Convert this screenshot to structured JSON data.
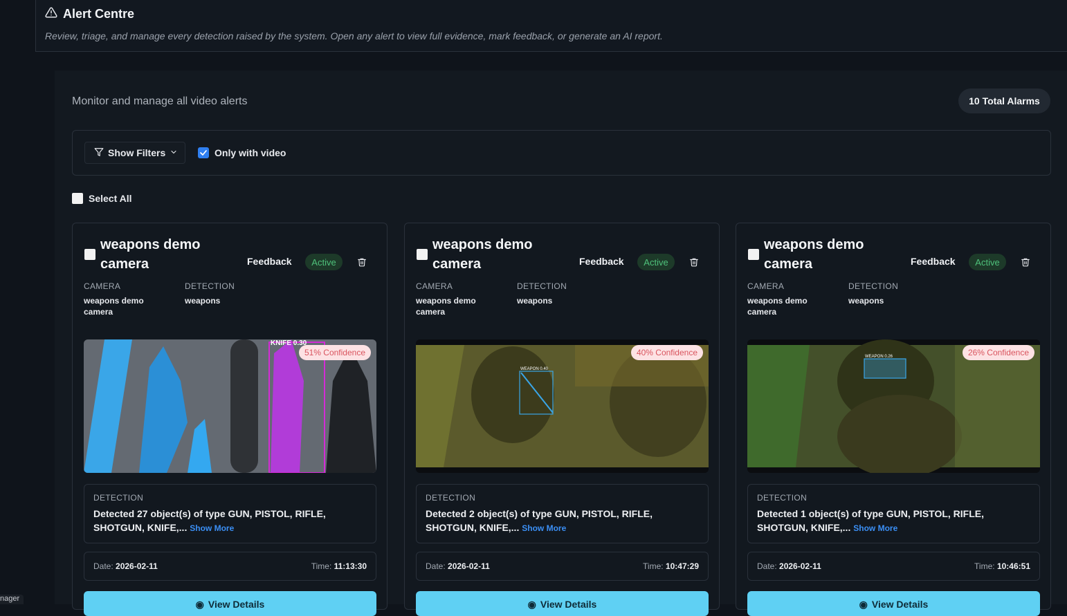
{
  "sidebar": {
    "tag_label": "nager"
  },
  "header": {
    "title": "Alert Centre",
    "subtitle": "Review, triage, and manage every detection raised by the system. Open any alert to view full evidence, mark feedback, or generate an AI report."
  },
  "main": {
    "monitor_text": "Monitor and manage all video alerts",
    "total_badge": "10 Total Alarms",
    "filters": {
      "show_filters_label": "Show Filters",
      "only_video_label": "Only with video",
      "only_video_checked": true
    },
    "select_all_label": "Select All"
  },
  "cards": [
    {
      "title": "weapons demo camera",
      "feedback_label": "Feedback",
      "status": "Active",
      "camera_label": "CAMERA",
      "camera_value": "weapons demo camera",
      "detection_label": "DETECTION",
      "detection_value": "weapons",
      "confidence": "51% Confidence",
      "overlay_label": "KNIFE 0.30",
      "detection_box_label": "DETECTION",
      "detection_text": "Detected 27 object(s) of type GUN, PISTOL, RIFLE, SHOTGUN, KNIFE,...",
      "show_more": "Show More",
      "date_label": "Date:",
      "date_value": "2026-02-11",
      "time_label": "Time:",
      "time_value": "11:13:30",
      "view_label": "View Details"
    },
    {
      "title": "weapons demo camera",
      "feedback_label": "Feedback",
      "status": "Active",
      "camera_label": "CAMERA",
      "camera_value": "weapons demo camera",
      "detection_label": "DETECTION",
      "detection_value": "weapons",
      "confidence": "40% Confidence",
      "overlay_label": "WEAPON 0.40",
      "detection_box_label": "DETECTION",
      "detection_text": "Detected 2 object(s) of type GUN, PISTOL, RIFLE, SHOTGUN, KNIFE,...",
      "show_more": "Show More",
      "date_label": "Date:",
      "date_value": "2026-02-11",
      "time_label": "Time:",
      "time_value": "10:47:29",
      "view_label": "View Details"
    },
    {
      "title": "weapons demo camera",
      "feedback_label": "Feedback",
      "status": "Active",
      "camera_label": "CAMERA",
      "camera_value": "weapons demo camera",
      "detection_label": "DETECTION",
      "detection_value": "weapons",
      "confidence": "26% Confidence",
      "overlay_label": "WEAPON 0.26",
      "detection_box_label": "DETECTION",
      "detection_text": "Detected 1 object(s) of type GUN, PISTOL, RIFLE, SHOTGUN, KNIFE,...",
      "show_more": "Show More",
      "date_label": "Date:",
      "date_value": "2026-02-11",
      "time_label": "Time:",
      "time_value": "10:46:51",
      "view_label": "View Details"
    }
  ]
}
